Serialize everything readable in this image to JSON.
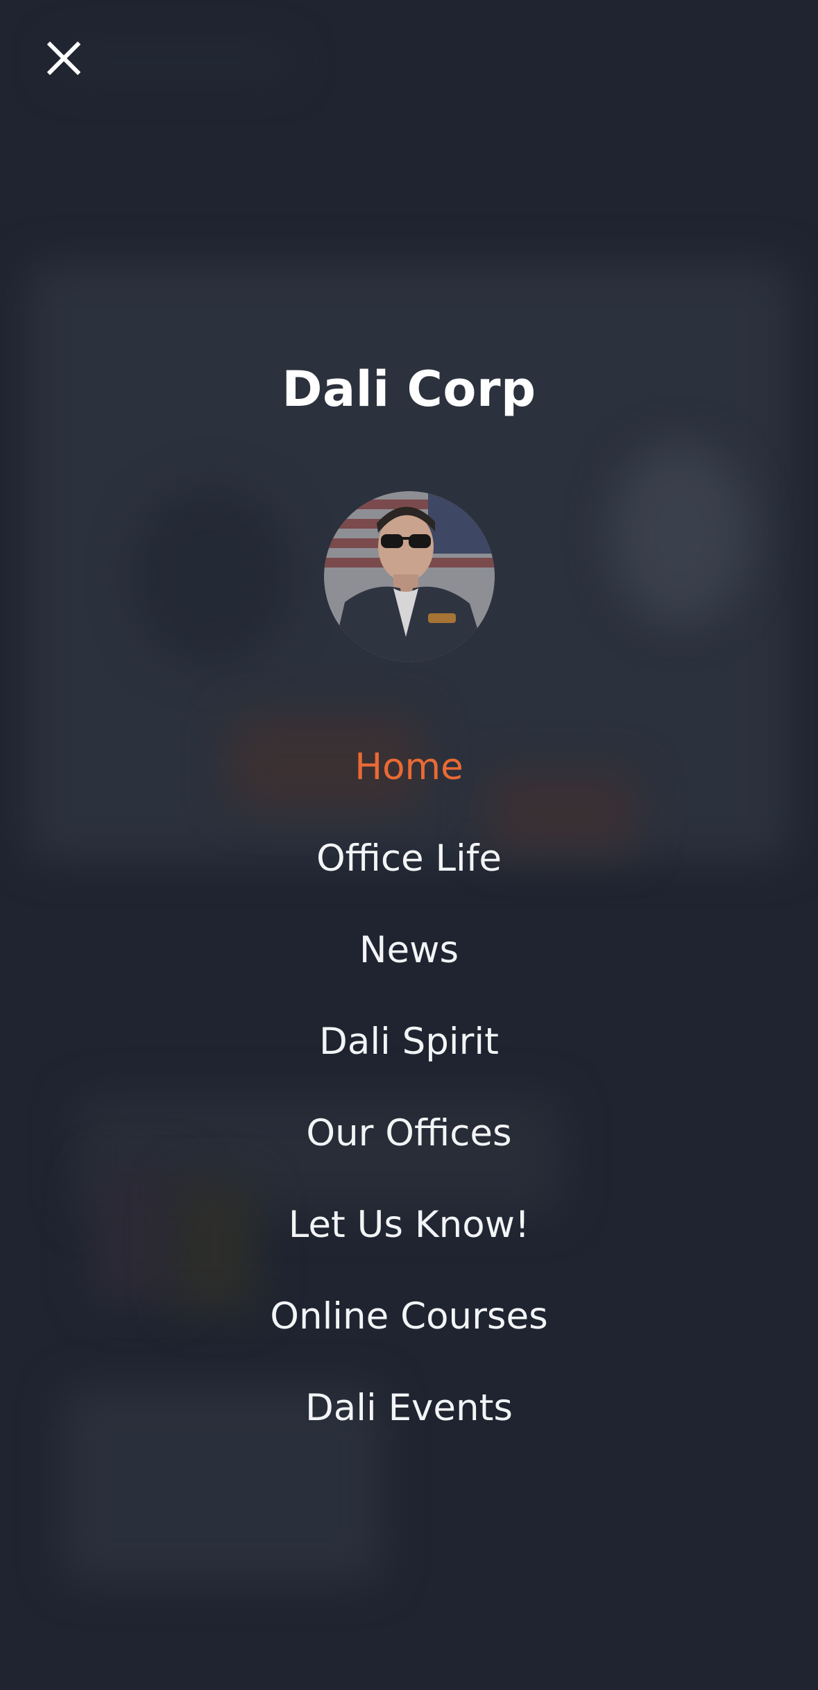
{
  "header": {
    "close_icon": "close-icon"
  },
  "profile": {
    "brand_name": "Dali Corp",
    "avatar_icon": "avatar"
  },
  "menu": {
    "items": [
      {
        "label": "Home",
        "active": true
      },
      {
        "label": "Office Life",
        "active": false
      },
      {
        "label": "News",
        "active": false
      },
      {
        "label": "Dali Spirit",
        "active": false
      },
      {
        "label": "Our Offices",
        "active": false
      },
      {
        "label": "Let Us Know!",
        "active": false
      },
      {
        "label": "Online Courses",
        "active": false
      },
      {
        "label": "Dali Events",
        "active": false
      }
    ]
  },
  "colors": {
    "background": "#1f2430",
    "accent": "#ea6a35",
    "text": "#f3f4f6"
  }
}
